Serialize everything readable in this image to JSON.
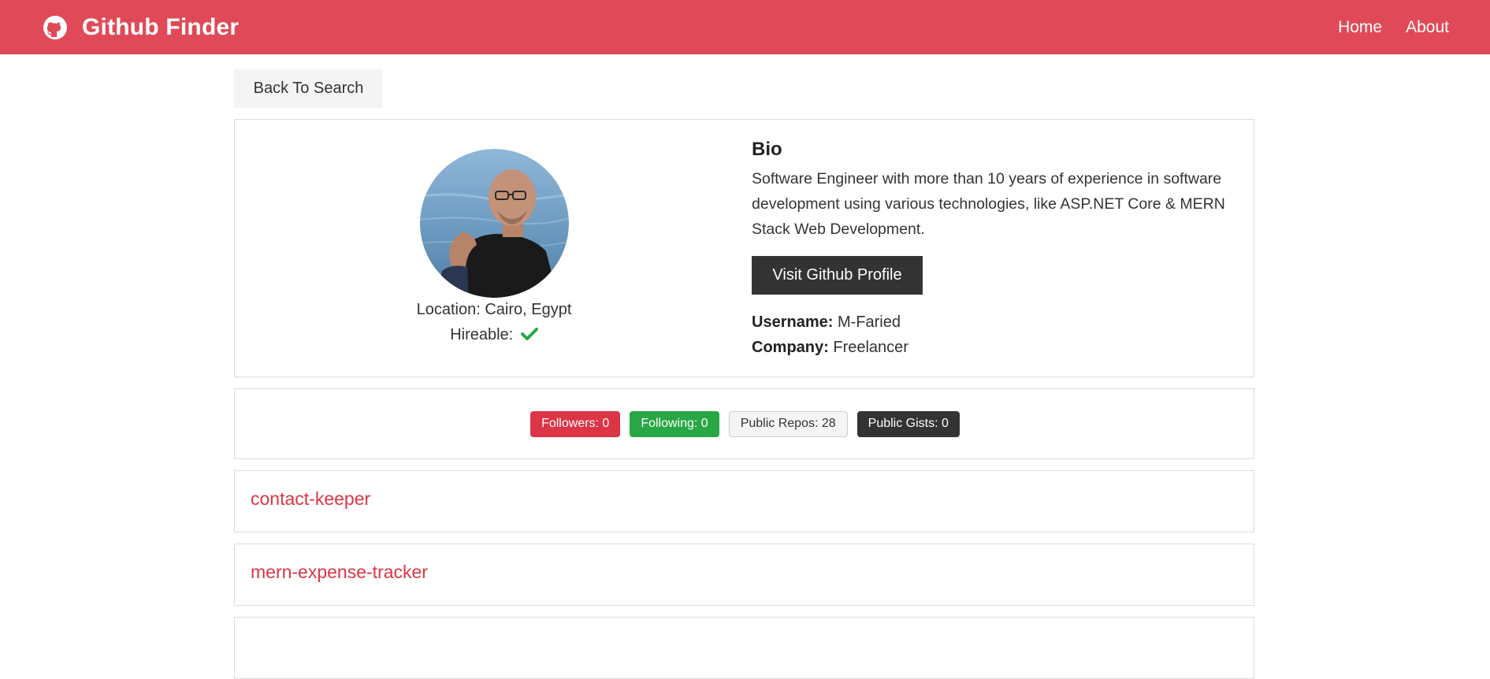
{
  "navbar": {
    "title": "Github Finder",
    "icon": "github-icon",
    "links": {
      "home": "Home",
      "about": "About"
    },
    "bg_color": "#e04a58"
  },
  "back_button": "Back To Search",
  "profile": {
    "location_label": "Location: Cairo, Egypt",
    "hireable_label": "Hireable:",
    "hireable_icon": "check-icon",
    "bio_heading": "Bio",
    "bio_text": "Software Engineer with more than 10 years of experience in software development using various technologies, like ASP.NET Core & MERN Stack Web Development.",
    "visit_button": "Visit Github Profile",
    "username_label": "Username:",
    "username_value": "M-Faried",
    "company_label": "Company:",
    "company_value": "Freelancer"
  },
  "badges": {
    "followers": "Followers: 0",
    "following": "Following: 0",
    "public_repos": "Public Repos: 28",
    "public_gists": "Public Gists: 0"
  },
  "repos": [
    "contact-keeper",
    "mern-expense-tracker"
  ],
  "colors": {
    "accent": "#dc3545",
    "success": "#28a745",
    "dark": "#333333",
    "light": "#f4f4f4"
  }
}
